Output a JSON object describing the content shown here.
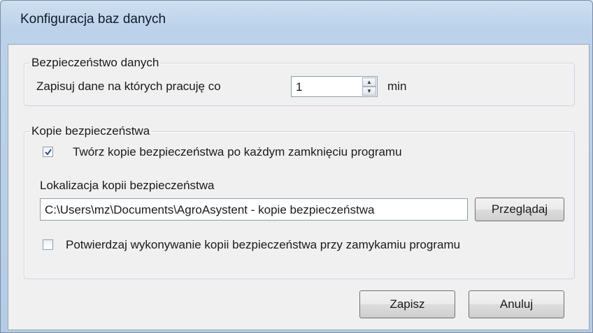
{
  "window": {
    "title": "Konfiguracja baz danych"
  },
  "data_security": {
    "legend": "Bezpieczeństwo danych",
    "save_label": "Zapisuj dane na których pracuję co",
    "interval_value": "1",
    "unit": "min"
  },
  "backups": {
    "legend": "Kopie bezpieczeństwa",
    "create_on_close": {
      "label": "Twórz kopie bezpieczeństwa po każdym zamknięciu programu",
      "checked": true
    },
    "location_label": "Lokalizacja kopii bezpieczeństwa",
    "location_value": "C:\\Users\\mz\\Documents\\AgroAsystent - kopie bezpieczeństwa",
    "browse_label": "Przeglądaj",
    "confirm_on_close": {
      "label": "Potwierdzaj wykonywanie kopii bezpieczeństwa przy zamykamiu programu",
      "checked": false
    }
  },
  "footer": {
    "save_label": "Zapisz",
    "cancel_label": "Anuluj"
  }
}
